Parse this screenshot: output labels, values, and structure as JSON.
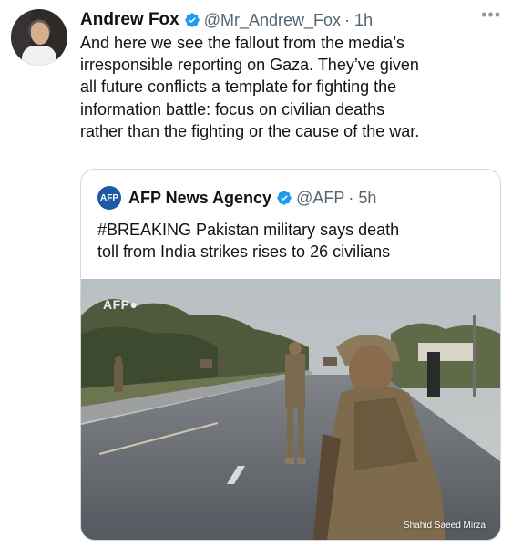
{
  "tweet": {
    "author_name": "Andrew Fox",
    "handle": "@Mr_Andrew_Fox",
    "time": "· 1h",
    "more": "•••",
    "text": "And here we see the fallout from the media’s\nirresponsible reporting on Gaza. They’ve given\nall future conflicts a template for fighting the\ninformation battle: focus on civilian deaths\nrather than the fighting or the cause of the war."
  },
  "quote": {
    "author_name": "AFP News Agency",
    "logo_text": "AFP",
    "handle": "@AFP",
    "time": "· 5h",
    "text": "#BREAKING Pakistan military says death\ntoll from India strikes rises to 26 civilians",
    "image": {
      "watermark": "AFP●",
      "credit": "Shahid Saeed Mirza"
    }
  },
  "colors": {
    "verified_blue": "#1d9bf0",
    "secondary_text": "#536471",
    "card_border": "#cfd9de"
  },
  "icons": [
    "verified-badge-icon",
    "more-options-icon",
    "afp-logo-icon"
  ]
}
